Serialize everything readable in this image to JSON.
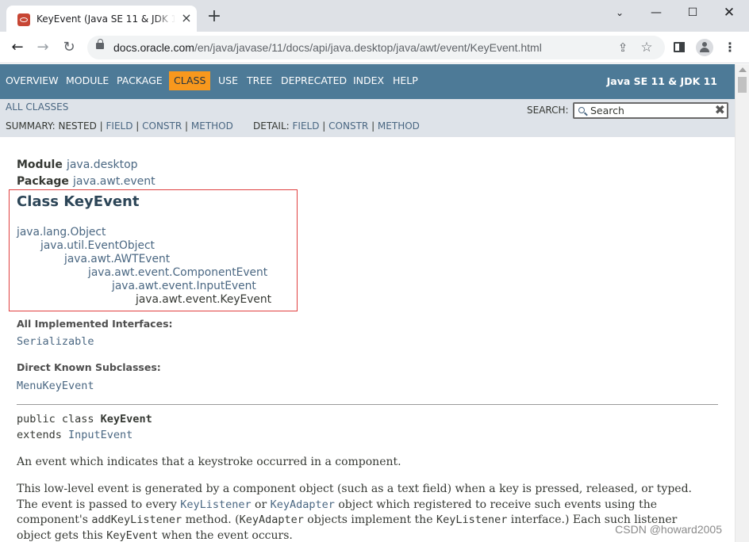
{
  "browser": {
    "tab_title": "KeyEvent (Java SE 11 & JDK 11",
    "tab_close": "×",
    "new_tab": "+",
    "window_controls": {
      "chevron": "⌄",
      "minimize": "—",
      "maximize": "☐",
      "close": "✕"
    },
    "url_host": "docs.oracle.com",
    "url_path": "/en/java/javase/11/docs/api/java.desktop/java/awt/event/KeyEvent.html",
    "icons": {
      "back": "←",
      "forward": "→",
      "reload": "↻",
      "share": "⇪",
      "star": "☆",
      "menu": "⋮"
    }
  },
  "topnav": {
    "items": [
      "OVERVIEW",
      "MODULE",
      "PACKAGE",
      "CLASS",
      "USE",
      "TREE",
      "DEPRECATED",
      "INDEX",
      "HELP"
    ],
    "active": "CLASS",
    "about": "Java SE 11 & JDK 11"
  },
  "subnav": {
    "all_classes": "ALL CLASSES",
    "summary_label": "SUMMARY:",
    "summary_items": [
      "NESTED",
      "FIELD",
      "CONSTR",
      "METHOD"
    ],
    "detail_label": "DETAIL:",
    "detail_items": [
      "FIELD",
      "CONSTR",
      "METHOD"
    ],
    "separator": " | ",
    "search_label": "SEARCH:",
    "search_placeholder": "Search",
    "search_reset": "✖"
  },
  "header": {
    "module_label": "Module",
    "module": "java.desktop",
    "package_label": "Package",
    "package": "java.awt.event",
    "title": "Class KeyEvent"
  },
  "inheritance": [
    "java.lang.Object",
    "java.util.EventObject",
    "java.awt.AWTEvent",
    "java.awt.event.ComponentEvent",
    "java.awt.event.InputEvent",
    "java.awt.event.KeyEvent"
  ],
  "interfaces": {
    "label": "All Implemented Interfaces:",
    "value": "Serializable"
  },
  "subclasses": {
    "label": "Direct Known Subclasses:",
    "value": "MenuKeyEvent"
  },
  "signature": {
    "line1_prefix": "public class ",
    "class_name": "KeyEvent",
    "line2_prefix": "extends ",
    "extends": "InputEvent"
  },
  "description": {
    "p1": "An event which indicates that a keystroke occurred in a component.",
    "p2_l1": "This low-level event is generated by a component object (such as a text field) when a key is pressed, released, or typed.",
    "p2_l2a": "The event is passed to every ",
    "p2_l2b": "KeyListener",
    "p2_l2c": " or ",
    "p2_l2d": "KeyAdapter",
    "p2_l2e": " object which registered to receive such events using the",
    "p2_l3a": "component's ",
    "p2_l3b": "addKeyListener",
    "p2_l3c": " method. (",
    "p2_l3d": "KeyAdapter",
    "p2_l3e": " objects implement the ",
    "p2_l3f": "KeyListener",
    "p2_l3g": " interface.) Each such listener",
    "p2_l4a": "object gets this ",
    "p2_l4b": "KeyEvent",
    "p2_l4c": " when the event occurs."
  },
  "watermark": "CSDN @howard2005"
}
